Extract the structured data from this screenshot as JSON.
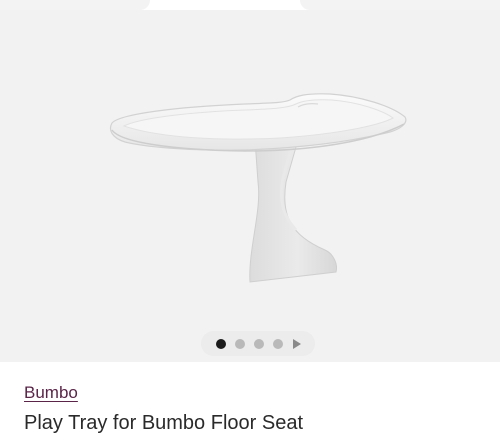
{
  "product": {
    "brand": "Bumbo",
    "title": "Play Tray for Bumbo Floor Seat"
  },
  "gallery": {
    "image_icon": "play-tray-product-image",
    "slide_count": 4,
    "active_slide": 1,
    "next_icon": "play-triangle-icon"
  },
  "colors": {
    "brand_link": "#5a2448",
    "gallery_bg": "#f2f2f2",
    "active_dot": "#1b1b1b",
    "inactive_dot": "#b9b9b9"
  }
}
